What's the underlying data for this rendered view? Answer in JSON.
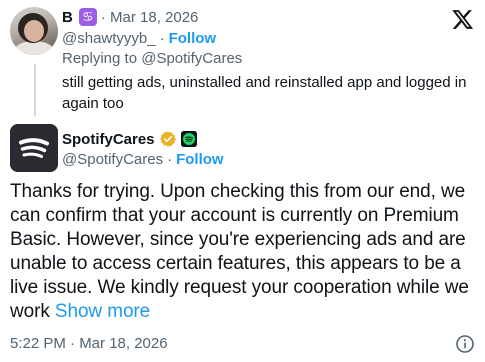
{
  "parent_tweet": {
    "display_name": "B",
    "zodiac_badge": "♋",
    "date": "· Mar 18, 2026",
    "handle": "@shawtyyyb_",
    "separator": "·",
    "follow_label": "Follow",
    "replying_to": "Replying to @SpotifyCares",
    "text": "still getting ads, uninstalled and reinstalled app and logged in again too"
  },
  "reply_tweet": {
    "display_name": "SpotifyCares",
    "handle": "@SpotifyCares",
    "separator": "·",
    "follow_label": "Follow",
    "body": "Thanks for trying. Upon checking this from our end, we can confirm that your account is currently on Premium Basic. However, since you're experiencing ads and are unable to access certain features, this appears to be a live issue. We kindly request your cooperation while we work ",
    "show_more_label": "Show more",
    "timestamp": "5:22 PM · Mar 18, 2026"
  },
  "icons": {
    "platform_logo": "x-logo-icon",
    "verified": "gold-verified-icon",
    "affiliate": "spotify-affiliate-icon",
    "info": "info-icon"
  },
  "colors": {
    "link": "#1d9bf0",
    "secondary_text": "#536471",
    "primary_text": "#0f1419",
    "verified_gold": "#e8b325",
    "spotify_green": "#1ed760",
    "zodiac_purple": "#9b5de5"
  }
}
